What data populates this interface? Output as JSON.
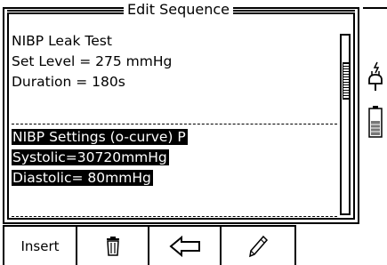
{
  "dialog": {
    "title": "Edit Sequence",
    "lines": {
      "l1": "NIBP Leak Test",
      "l2": "Set Level = 275 mmHg",
      "l3": "Duration = 180s",
      "l4": "NIBP Settings (o-curve) P",
      "l5": "Systolic=30720mmHg",
      "l6": "Diastolic= 80mmHg"
    }
  },
  "softkeys": {
    "insert_label": "Insert",
    "delete_icon": "trash-icon",
    "back_icon": "left-arrow-icon",
    "edit_icon": "pencil-icon"
  },
  "status": {
    "power_icon": "mains-plug-icon",
    "battery_icon": "battery-icon"
  }
}
